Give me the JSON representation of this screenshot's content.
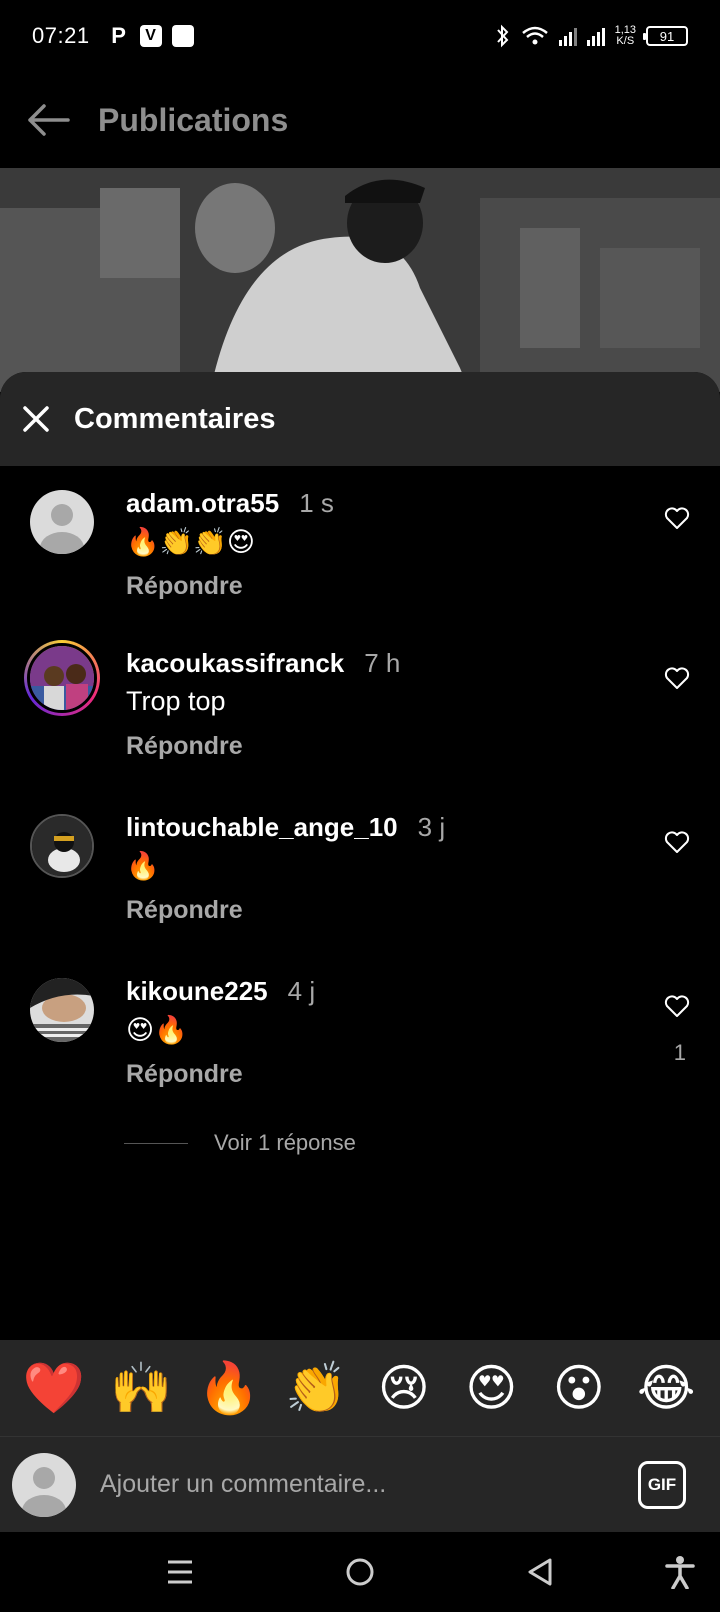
{
  "status_bar": {
    "time": "07:21",
    "apps": [
      "P",
      "V",
      ""
    ],
    "net_speed_value": "1,13",
    "net_speed_unit": "K/S",
    "battery": "91"
  },
  "header": {
    "title": "Publications"
  },
  "sheet": {
    "title": "Commentaires"
  },
  "comments": [
    {
      "user": "adam.otra55",
      "time": "1 s",
      "text": "🔥👏👏😍",
      "reply": "Répondre",
      "likes": ""
    },
    {
      "user": "kacoukassifranck",
      "time": "7 h",
      "text": "Trop top",
      "reply": "Répondre",
      "likes": ""
    },
    {
      "user": "lintouchable_ange_10",
      "time": "3 j",
      "text": "🔥",
      "reply": "Répondre",
      "likes": ""
    },
    {
      "user": "kikoune225",
      "time": "4 j",
      "text": "😍🔥",
      "reply": "Répondre",
      "likes": "1"
    }
  ],
  "view_replies": "Voir 1 réponse",
  "emoji_bar": [
    "❤️",
    "🙌",
    "🔥",
    "👏",
    "😢",
    "😍",
    "😮",
    "😂"
  ],
  "input": {
    "placeholder": "Ajouter un commentaire...",
    "gif_label": "GIF"
  },
  "colors": {
    "background": "#000000",
    "sheet_header": "#262626",
    "muted_text": "#a8a8a8"
  }
}
